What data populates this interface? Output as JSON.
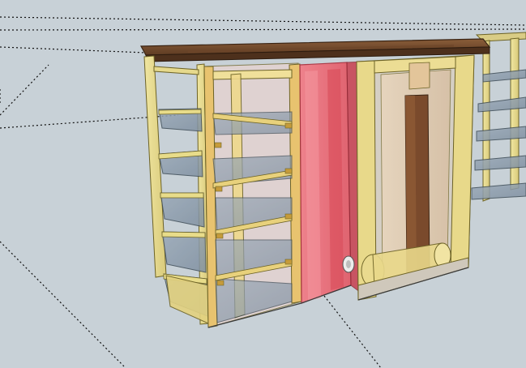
{
  "app": {
    "kind": "3d-model-viewport"
  },
  "colors": {
    "background": "#c8d1d7",
    "wood_frame": "#e8dc8a",
    "wood_edge": "#6d6326",
    "wood_top": "#7a5132",
    "wood_top_dark": "#4d301c",
    "glass": "#8f9fb0",
    "pink_panel": "#f06a75",
    "pink_panel_dark": "#b93a48",
    "beige_panel": "#e6cdb0",
    "brown_post": "#6b4128",
    "axis_dots": "#000000"
  }
}
